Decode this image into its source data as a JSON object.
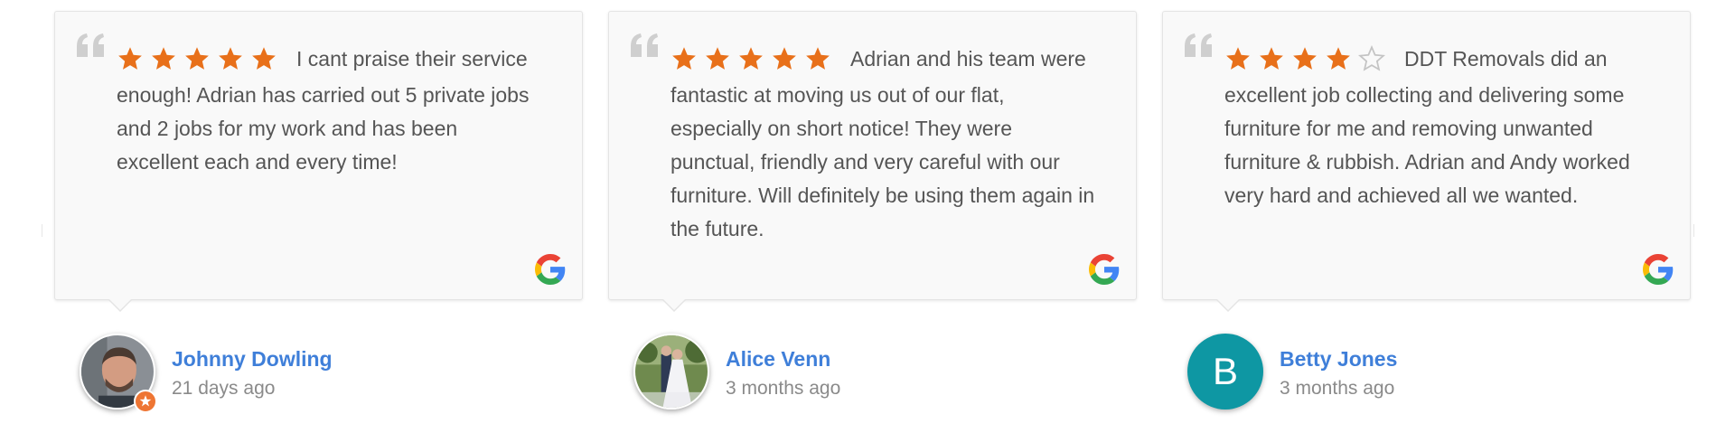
{
  "colors": {
    "star_filled": "#e8701a",
    "star_empty": "#c4c4c4",
    "author_link": "#3f7fd9",
    "letter_avatar_bg": "#0e97a3",
    "badge": "#ee7533"
  },
  "reviews": [
    {
      "rating": 5,
      "text": "I cant praise their service enough! Adrian has carried out 5 private jobs and 2 jobs for my work and has been excellent each and every time!",
      "author": "Johnny Dowling",
      "date": "21 days ago",
      "avatar": "photo-man",
      "source_icon": "google-icon"
    },
    {
      "rating": 5,
      "text": "Adrian and his team were fantastic at moving us out of our flat, especially on short notice! They were punctual, friendly and very careful with our furniture. Will definitely be using them again in the future.",
      "author": "Alice Venn",
      "date": "3 months ago",
      "avatar": "photo-wedding",
      "source_icon": "google-icon"
    },
    {
      "rating": 4,
      "text": "DDT Removals did an excellent job collecting and delivering some furniture for me and removing unwanted furniture & rubbish. Adrian and Andy worked very hard and achieved all we wanted.",
      "author": "Betty Jones",
      "date": "3 months ago",
      "avatar_letter": "B",
      "source_icon": "google-icon"
    }
  ]
}
